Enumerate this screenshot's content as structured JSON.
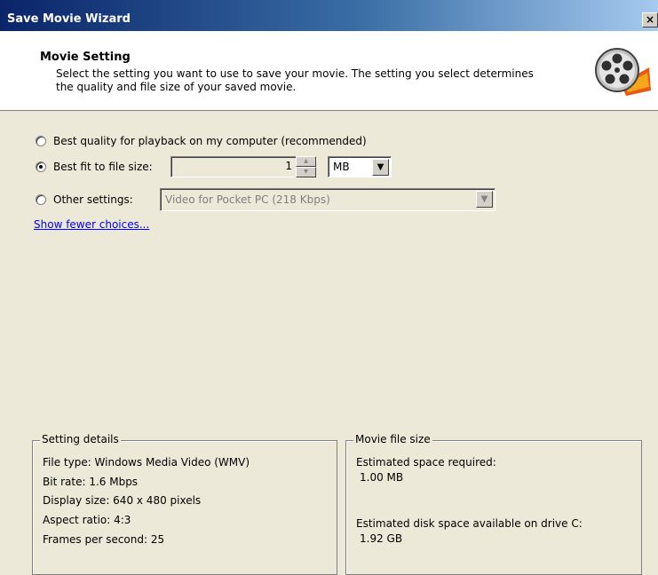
{
  "window": {
    "title": "Save Movie Wizard",
    "close_label": "×"
  },
  "header": {
    "title": "Movie Setting",
    "description": "Select the setting you want to use to save your movie. The setting you select determines the quality and file size of your saved movie."
  },
  "options": {
    "best_quality": {
      "label": "Best quality for playback on my computer (recommended)",
      "selected": false
    },
    "best_fit": {
      "label": "Best fit to file size:",
      "selected": true,
      "value": "1",
      "unit": "MB"
    },
    "other": {
      "label": "Other settings:",
      "selected": false,
      "value": "Video for Pocket PC (218 Kbps)"
    }
  },
  "link": {
    "label": "Show fewer choices..."
  },
  "setting_details": {
    "title": "Setting details",
    "file_type": "File type: Windows Media Video (WMV)",
    "bit_rate": "Bit rate: 1.6 Mbps",
    "display_size": "Display size: 640 x 480 pixels",
    "aspect_ratio": "Aspect ratio: 4:3",
    "fps": "Frames per second: 25"
  },
  "movie_file_size": {
    "title": "Movie file size",
    "estimated_label": "Estimated space required:",
    "estimated_value": "1.00 MB",
    "disk_label": "Estimated disk space available on drive C:",
    "disk_value": "1.92 GB"
  },
  "icons": {
    "header_icon": "film-reel-icon"
  },
  "colors": {
    "title_bar": "#0a246a",
    "link": "#0000ff",
    "background": "#ece9d8"
  }
}
